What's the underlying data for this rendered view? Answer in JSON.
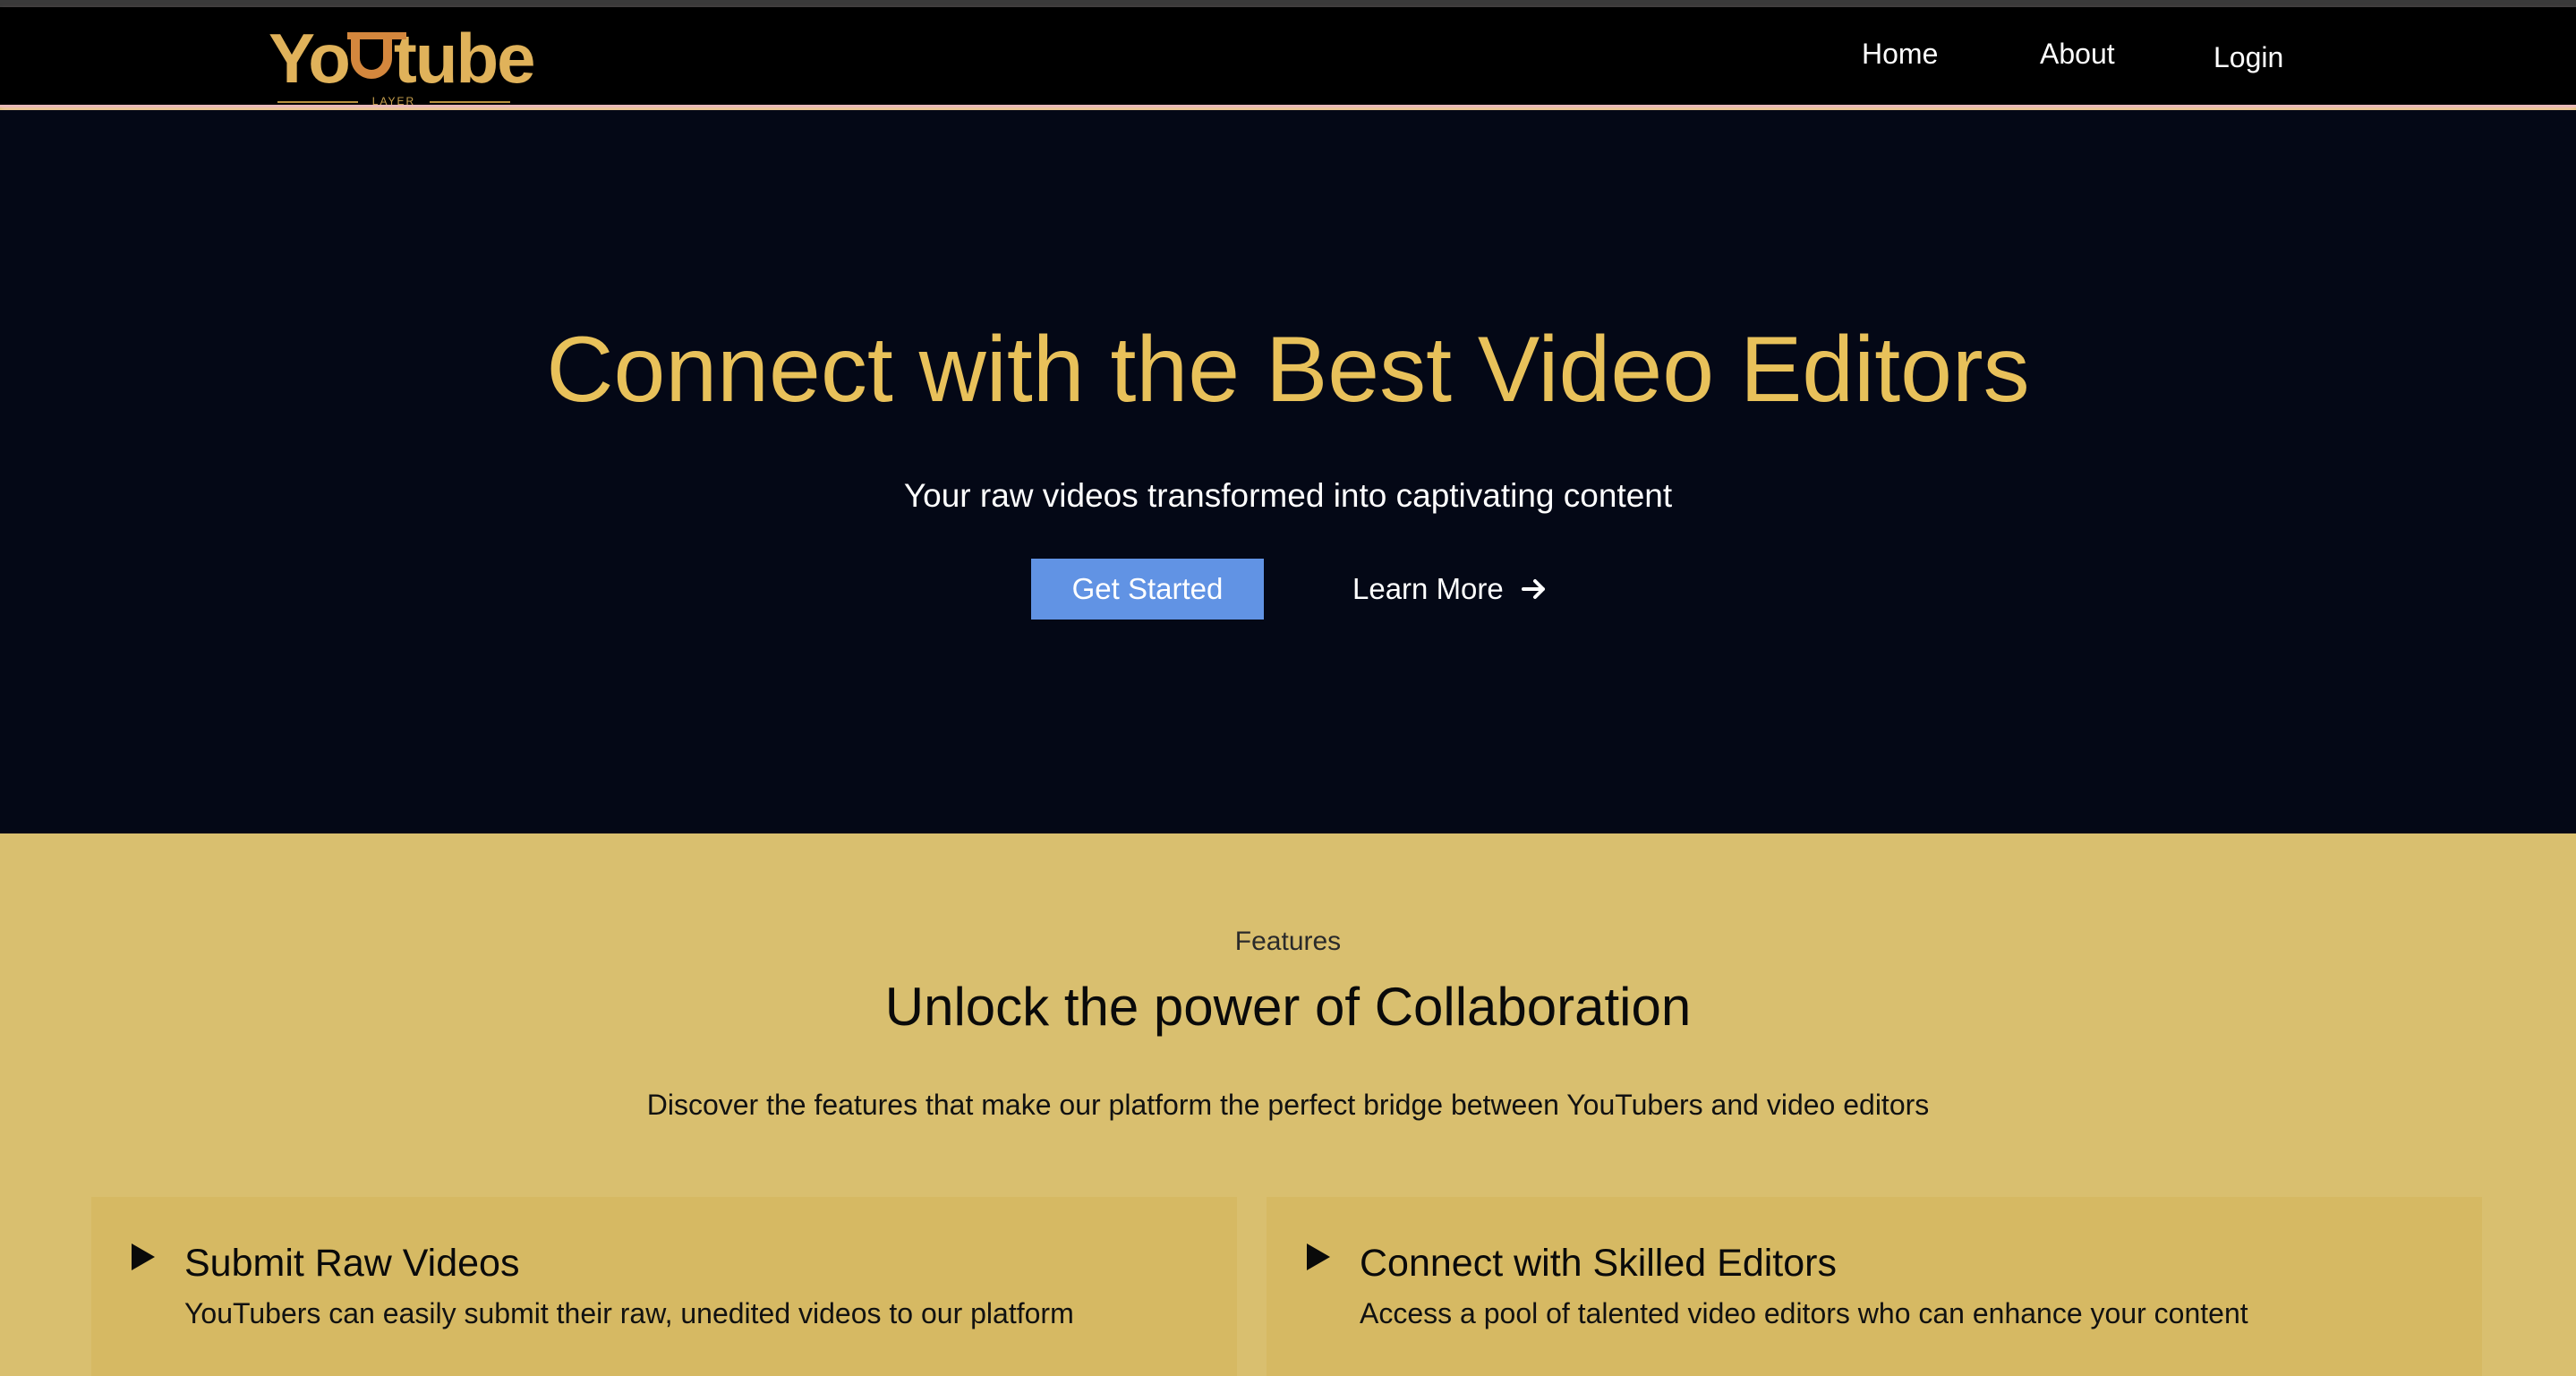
{
  "logo": {
    "word_left": "Yo",
    "word_right": "tube",
    "subtitle": "LAYER"
  },
  "nav": {
    "home": "Home",
    "about": "About",
    "login": "Login"
  },
  "hero": {
    "title": "Connect with the Best Video Editors",
    "subtitle": "Your raw videos transformed into captivating content",
    "get_started": "Get Started",
    "learn_more": "Learn More",
    "learn_more_icon": "arrow-right-icon"
  },
  "features": {
    "kicker": "Features",
    "title": "Unlock the power of Collaboration",
    "description": "Discover the features that make our platform the perfect bridge between YouTubers and video editors",
    "cards": [
      {
        "icon": "play-icon",
        "title": "Submit Raw Videos",
        "text": "YouTubers can easily submit their raw, unedited videos to our platform"
      },
      {
        "icon": "play-icon",
        "title": "Connect with Skilled Editors",
        "text": "Access a pool of talented video editors who can enhance your content"
      }
    ]
  },
  "colors": {
    "hero_bg": "#040816",
    "accent_gold": "#e8c15a",
    "features_bg": "#d9bf6f",
    "card_bg": "#d6b963",
    "button_blue": "#6193e4"
  }
}
